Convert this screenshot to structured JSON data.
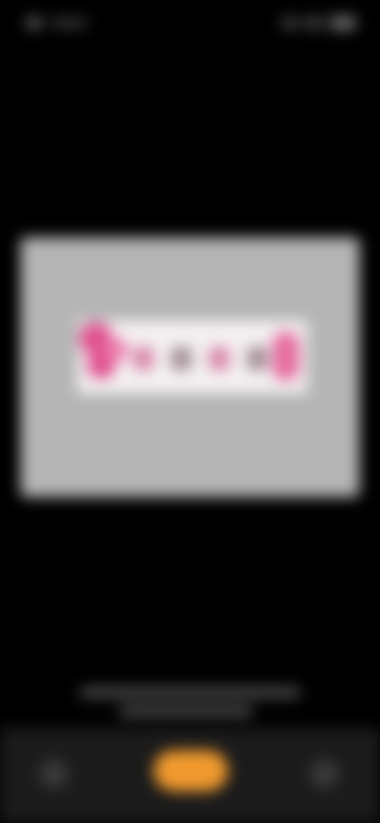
{
  "status_bar": {
    "time": "",
    "icons": [
      "wifi-icon",
      "signal-icon",
      "battery-icon"
    ]
  },
  "photo": {
    "background_color": "#b5b5b5",
    "sign_color": "#f4f1f2",
    "accent_color": "#e04f8f"
  },
  "caption": {
    "line1": "",
    "line2": ""
  },
  "bottom_bar": {
    "left_icon": "back-icon",
    "center_button_color": "#f19a2e",
    "right_icon": "options-icon"
  }
}
